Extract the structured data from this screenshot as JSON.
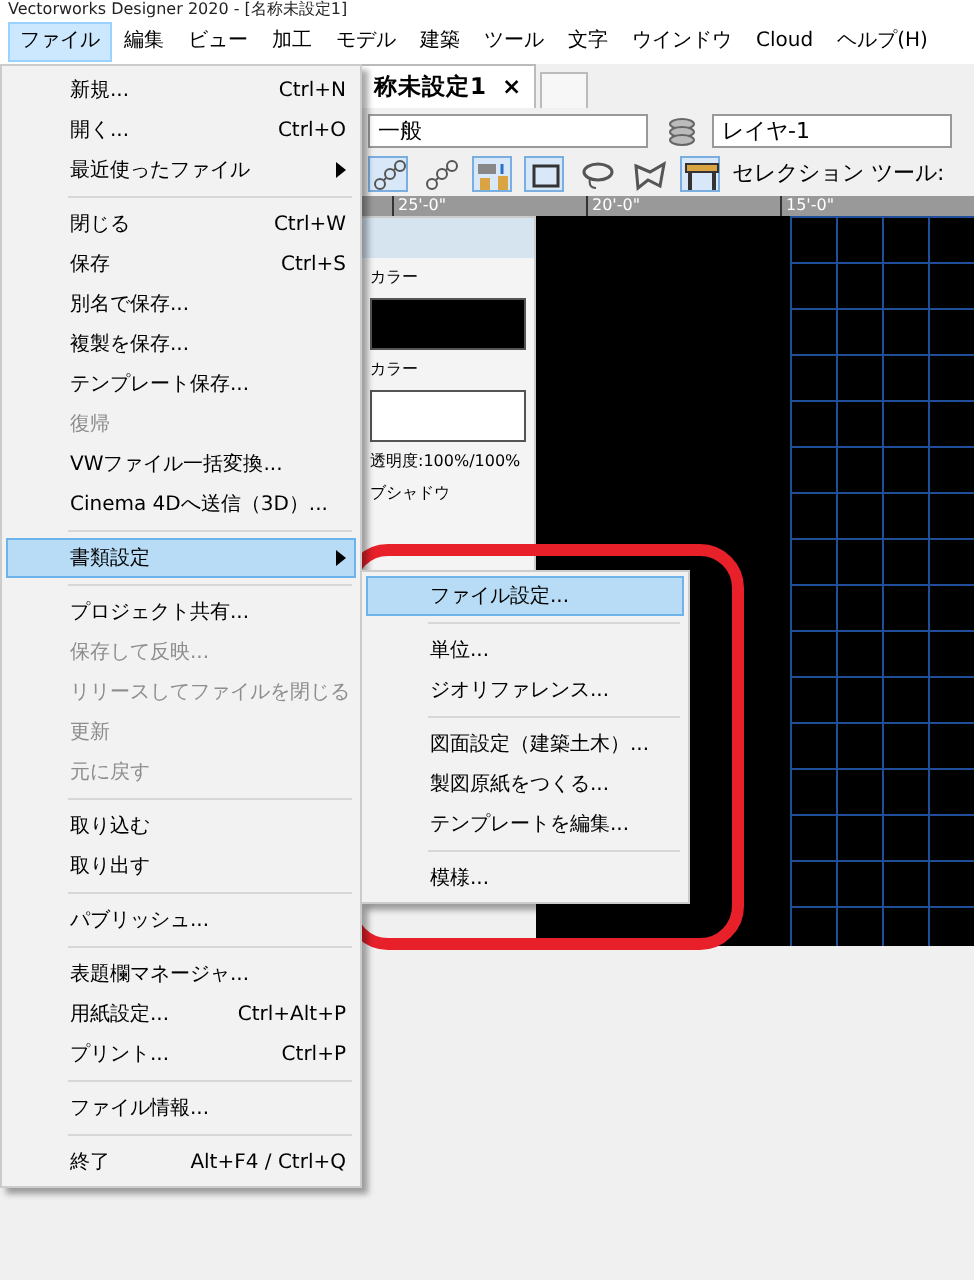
{
  "window": {
    "title": "Vectorworks Designer 2020 - [名称未設定1]"
  },
  "menu_bar": [
    {
      "label": "ファイル",
      "selected": true
    },
    {
      "label": "編集",
      "selected": false
    },
    {
      "label": "ビュー",
      "selected": false
    },
    {
      "label": "加工",
      "selected": false
    },
    {
      "label": "モデル",
      "selected": false
    },
    {
      "label": "建築",
      "selected": false
    },
    {
      "label": "ツール",
      "selected": false
    },
    {
      "label": "文字",
      "selected": false
    },
    {
      "label": "ウインドウ",
      "selected": false
    },
    {
      "label": "Cloud",
      "selected": false
    },
    {
      "label": "ヘルプ(H)",
      "selected": false
    }
  ],
  "document_tab": {
    "label": "称未設定1",
    "close": "×"
  },
  "class_field": {
    "value": "一般"
  },
  "layer_field": {
    "value": "レイヤ-1"
  },
  "tool_label": "セレクション ツール:",
  "ruler": [
    "25'-0\"",
    "20'-0\"",
    "15'-0\""
  ],
  "palette": {
    "fill_label": "カラー",
    "pen_label": "カラー",
    "opacity": "透明度:100%/100%",
    "shadow_label": "ブシャドウ"
  },
  "file_menu": [
    {
      "kind": "item",
      "label": "新規...",
      "shortcut": "Ctrl+N",
      "disabled": false,
      "selected": false
    },
    {
      "kind": "item",
      "label": "開く...",
      "shortcut": "Ctrl+O",
      "disabled": false,
      "selected": false
    },
    {
      "kind": "submenu",
      "label": "最近使ったファイル",
      "disabled": false,
      "selected": false
    },
    {
      "kind": "separator"
    },
    {
      "kind": "item",
      "label": "閉じる",
      "shortcut": "Ctrl+W",
      "disabled": false,
      "selected": false
    },
    {
      "kind": "item",
      "label": "保存",
      "shortcut": "Ctrl+S",
      "disabled": false,
      "selected": false
    },
    {
      "kind": "item",
      "label": "別名で保存...",
      "disabled": false,
      "selected": false
    },
    {
      "kind": "item",
      "label": "複製を保存...",
      "disabled": false,
      "selected": false
    },
    {
      "kind": "item",
      "label": "テンプレート保存...",
      "disabled": false,
      "selected": false
    },
    {
      "kind": "item",
      "label": "復帰",
      "disabled": true,
      "selected": false
    },
    {
      "kind": "item",
      "label": "VWファイル一括変換...",
      "disabled": false,
      "selected": false
    },
    {
      "kind": "item",
      "label": "Cinema 4Dへ送信（3D）...",
      "disabled": false,
      "selected": false
    },
    {
      "kind": "separator"
    },
    {
      "kind": "submenu",
      "label": "書類設定",
      "disabled": false,
      "selected": true
    },
    {
      "kind": "separator"
    },
    {
      "kind": "item",
      "label": "プロジェクト共有...",
      "disabled": false,
      "selected": false
    },
    {
      "kind": "item",
      "label": "保存して反映...",
      "disabled": true,
      "selected": false
    },
    {
      "kind": "item",
      "label": "リリースしてファイルを閉じる",
      "disabled": true,
      "selected": false
    },
    {
      "kind": "item",
      "label": "更新",
      "disabled": true,
      "selected": false
    },
    {
      "kind": "item",
      "label": "元に戻す",
      "disabled": true,
      "selected": false
    },
    {
      "kind": "separator"
    },
    {
      "kind": "item",
      "label": "取り込む",
      "disabled": false,
      "selected": false
    },
    {
      "kind": "item",
      "label": "取り出す",
      "disabled": false,
      "selected": false
    },
    {
      "kind": "separator"
    },
    {
      "kind": "item",
      "label": "パブリッシュ...",
      "disabled": false,
      "selected": false
    },
    {
      "kind": "separator"
    },
    {
      "kind": "item",
      "label": "表題欄マネージャ...",
      "disabled": false,
      "selected": false
    },
    {
      "kind": "item",
      "label": "用紙設定...",
      "shortcut": "Ctrl+Alt+P",
      "disabled": false,
      "selected": false
    },
    {
      "kind": "item",
      "label": "プリント...",
      "shortcut": "Ctrl+P",
      "disabled": false,
      "selected": false
    },
    {
      "kind": "separator"
    },
    {
      "kind": "item",
      "label": "ファイル情報...",
      "disabled": false,
      "selected": false
    },
    {
      "kind": "separator"
    },
    {
      "kind": "item",
      "label": "終了",
      "shortcut": "Alt+F4 / Ctrl+Q",
      "disabled": false,
      "selected": false
    }
  ],
  "document_settings_menu": [
    {
      "kind": "item",
      "label": "ファイル設定...",
      "disabled": false,
      "selected": true
    },
    {
      "kind": "separator"
    },
    {
      "kind": "item",
      "label": "単位...",
      "disabled": false,
      "selected": false
    },
    {
      "kind": "item",
      "label": "ジオリファレンス...",
      "disabled": false,
      "selected": false
    },
    {
      "kind": "separator"
    },
    {
      "kind": "item",
      "label": "図面設定（建築土木）...",
      "disabled": false,
      "selected": false
    },
    {
      "kind": "item",
      "label": "製図原紙をつくる...",
      "disabled": false,
      "selected": false
    },
    {
      "kind": "item",
      "label": "テンプレートを編集...",
      "disabled": false,
      "selected": false
    },
    {
      "kind": "separator"
    },
    {
      "kind": "item",
      "label": "模様...",
      "disabled": false,
      "selected": false
    }
  ]
}
